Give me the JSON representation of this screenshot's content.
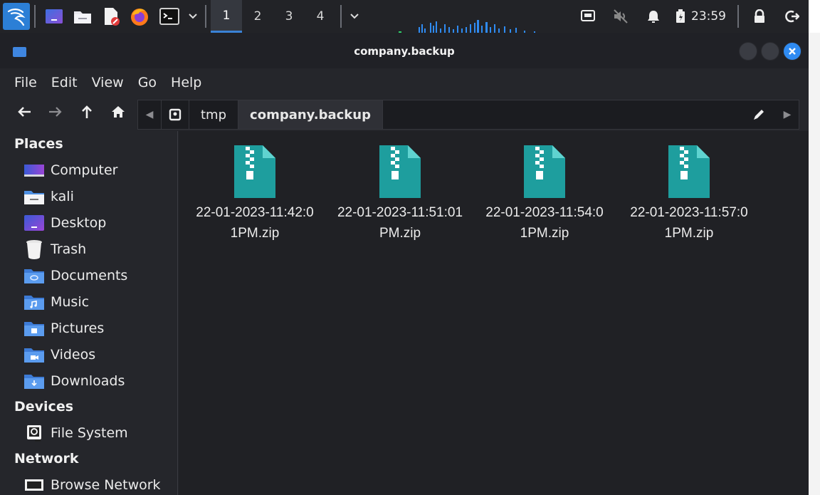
{
  "taskbar": {
    "workspaces": [
      "1",
      "2",
      "3",
      "4"
    ],
    "active_workspace": "1",
    "clock": "23:59",
    "icons": [
      "kali-menu-icon",
      "show-desktop-icon",
      "file-manager-icon",
      "text-editor-icon",
      "firefox-icon",
      "terminal-icon",
      "dropdown-icon",
      "network-icon",
      "speaker-muted-icon",
      "notification-bell-icon",
      "battery-icon",
      "lock-icon",
      "logout-icon"
    ]
  },
  "window": {
    "title": "company.backup",
    "accent": "#2f8bf2"
  },
  "menubar": {
    "items": [
      "File",
      "Edit",
      "View",
      "Go",
      "Help"
    ]
  },
  "pathbar": {
    "segments": [
      "tmp",
      "company.backup"
    ],
    "current": "company.backup"
  },
  "sidebar": {
    "places_header": "Places",
    "places": [
      {
        "label": "Computer",
        "icon": "computer-icon"
      },
      {
        "label": "kali",
        "icon": "home-folder-icon"
      },
      {
        "label": "Desktop",
        "icon": "desktop-icon"
      },
      {
        "label": "Trash",
        "icon": "trash-icon"
      },
      {
        "label": "Documents",
        "icon": "documents-folder-icon"
      },
      {
        "label": "Music",
        "icon": "music-folder-icon"
      },
      {
        "label": "Pictures",
        "icon": "pictures-folder-icon"
      },
      {
        "label": "Videos",
        "icon": "videos-folder-icon"
      },
      {
        "label": "Downloads",
        "icon": "downloads-folder-icon"
      }
    ],
    "devices_header": "Devices",
    "devices": [
      {
        "label": "File System",
        "icon": "drive-icon"
      }
    ],
    "network_header": "Network",
    "network": [
      {
        "label": "Browse Network",
        "icon": "network-icon"
      }
    ]
  },
  "files": [
    {
      "name": "22-01-2023-11:42:01PM.zip",
      "line1": "22-01-2023-11:42:0",
      "line2": "1PM.zip"
    },
    {
      "name": "22-01-2023-11:51:01PM.zip",
      "line1": "22-01-2023-11:51:01",
      "line2": "PM.zip"
    },
    {
      "name": "22-01-2023-11:54:01PM.zip",
      "line1": "22-01-2023-11:54:0",
      "line2": "1PM.zip"
    },
    {
      "name": "22-01-2023-11:57:01PM.zip",
      "line1": "22-01-2023-11:57:0",
      "line2": "1PM.zip"
    }
  ]
}
